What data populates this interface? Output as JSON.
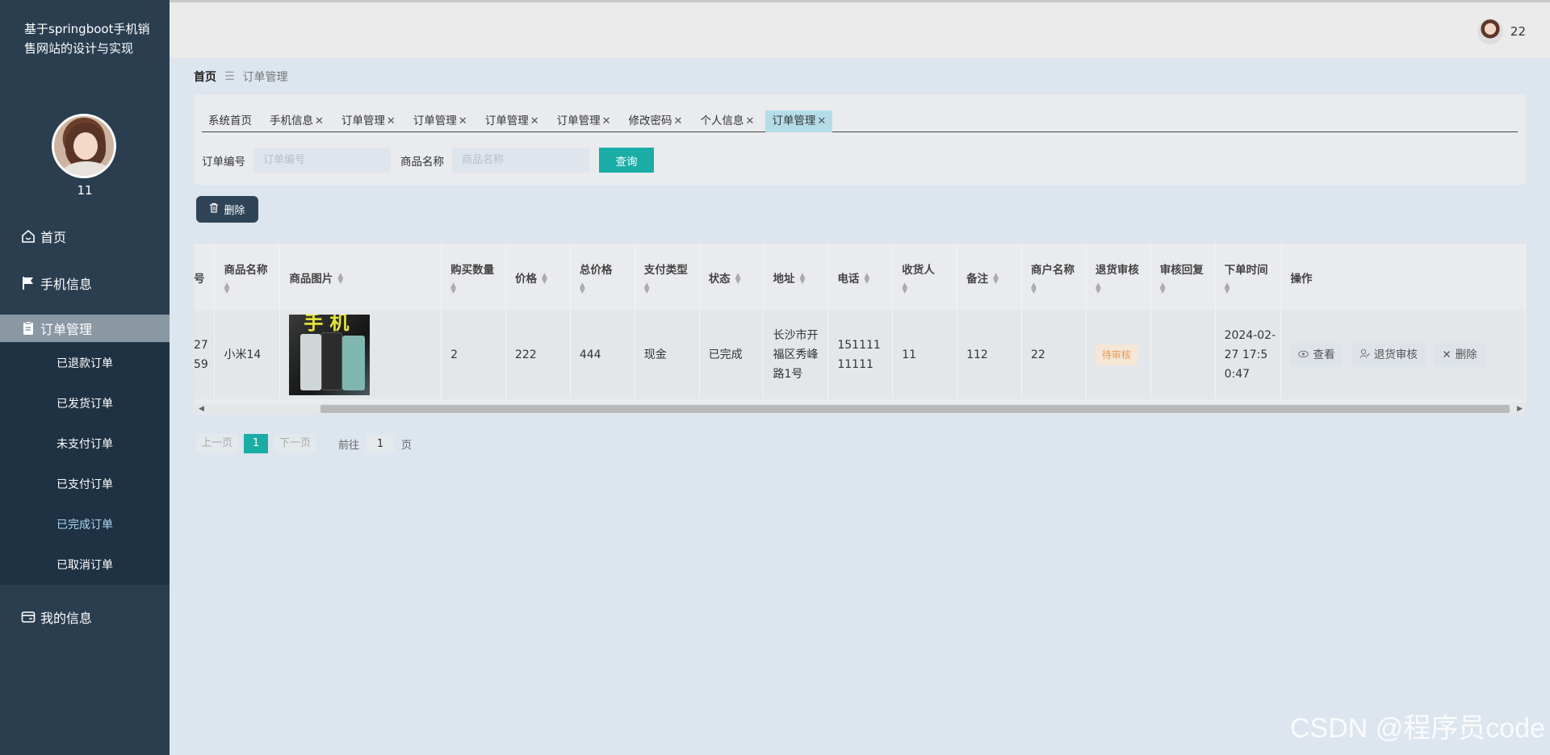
{
  "sidebar": {
    "site_title": "基于springboot手机销售网站的设计与实现",
    "user_name": "11",
    "menu": {
      "home": "首页",
      "phone_info": "手机信息",
      "order_mgmt": "订单管理",
      "my_info": "我的信息"
    },
    "submenu": [
      "已退款订单",
      "已发货订单",
      "未支付订单",
      "已支付订单",
      "已完成订单",
      "已取消订单"
    ]
  },
  "header": {
    "user": "22"
  },
  "breadcrumb": {
    "home": "首页",
    "current": "订单管理"
  },
  "tabs": [
    {
      "label": "系统首页",
      "closable": false
    },
    {
      "label": "手机信息",
      "closable": true
    },
    {
      "label": "订单管理",
      "closable": true
    },
    {
      "label": "订单管理",
      "closable": true
    },
    {
      "label": "订单管理",
      "closable": true
    },
    {
      "label": "订单管理",
      "closable": true
    },
    {
      "label": "修改密码",
      "closable": true
    },
    {
      "label": "个人信息",
      "closable": true
    },
    {
      "label": "订单管理",
      "closable": true,
      "active": true
    }
  ],
  "filters": {
    "order_no_label": "订单编号",
    "order_no_placeholder": "订单编号",
    "product_name_label": "商品名称",
    "product_name_placeholder": "商品名称",
    "query_button": "查询"
  },
  "delete_button": "删除",
  "table": {
    "headers": [
      "号",
      "商品名称",
      "商品图片",
      "购买数量",
      "价格",
      "总价格",
      "支付类型",
      "状态",
      "地址",
      "电话",
      "收货人",
      "备注",
      "商户名称",
      "退货审核",
      "审核回复",
      "下单时间",
      "操作"
    ],
    "row": {
      "order_no": "27\n59",
      "product_name": "小米14",
      "image_text": "手机",
      "quantity": "2",
      "price": "222",
      "total": "444",
      "pay_type": "现金",
      "status": "已完成",
      "address": "长沙市开福区秀峰路1号",
      "phone": "15111111111",
      "receiver": "11",
      "remark": "112",
      "merchant": "22",
      "return_review": "待审核",
      "review_reply": "",
      "order_time": "2024-02-27 17:50:47",
      "actions": {
        "view": "查看",
        "return_review": "退货审核",
        "delete": "删除"
      }
    }
  },
  "pager": {
    "prev": "上一页",
    "current": "1",
    "next": "下一页",
    "goto_label": "前往",
    "goto_value": "1",
    "page_suffix": "页"
  },
  "watermark": "CSDN @程序员code",
  "colors": {
    "sidebar": "#2a3e50",
    "accent": "#1aada6",
    "active_tab": "#b5dde9"
  }
}
